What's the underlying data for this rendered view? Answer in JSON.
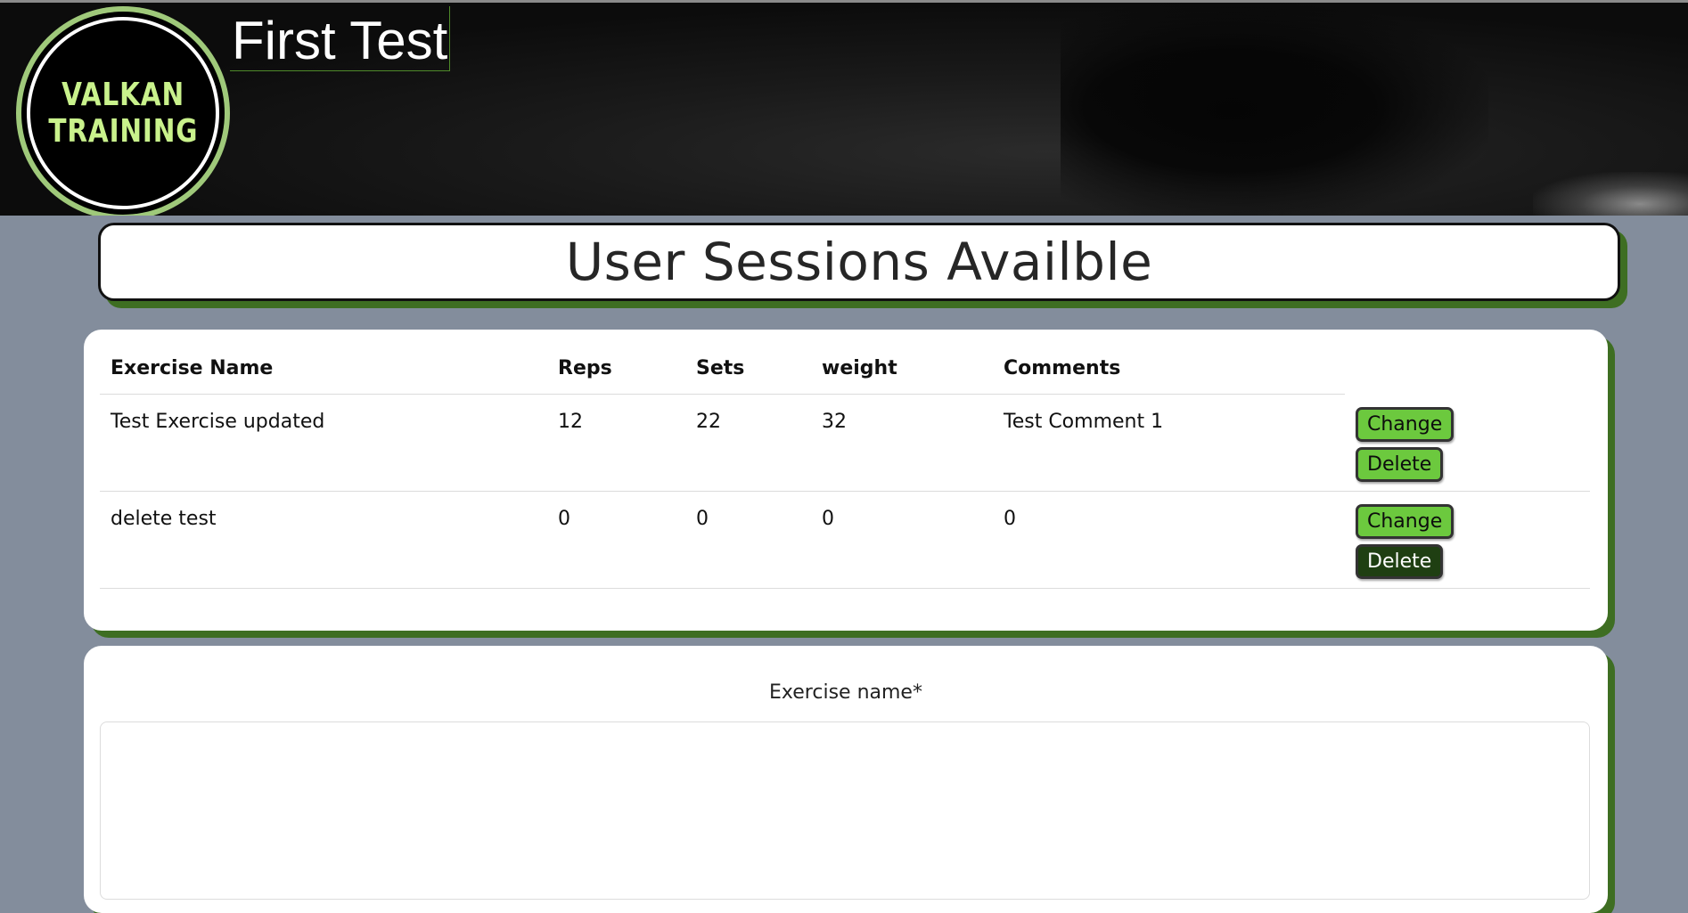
{
  "header": {
    "logo_line1": "VALKAN",
    "logo_line2": "TRAINING",
    "site_title": "First Test"
  },
  "page_title": "User Sessions Availble",
  "table": {
    "columns": [
      "Exercise Name",
      "Reps",
      "Sets",
      "weight",
      "Comments"
    ],
    "rows": [
      {
        "exercise_name": "Test Exercise updated",
        "reps": "12",
        "sets": "22",
        "weight": "32",
        "comments": "Test Comment 1",
        "change_label": "Change",
        "delete_label": "Delete"
      },
      {
        "exercise_name": "delete test",
        "reps": "0",
        "sets": "0",
        "weight": "0",
        "comments": "0",
        "change_label": "Change",
        "delete_label": "Delete"
      }
    ]
  },
  "form": {
    "exercise_name_label": "Exercise name*",
    "exercise_name_value": ""
  },
  "colors": {
    "accent_green": "#6cc93e",
    "dark_green": "#1f3f12",
    "shadow_green": "#3e6e22",
    "page_background": "#838d9c",
    "logo_text": "#c9f28c"
  }
}
